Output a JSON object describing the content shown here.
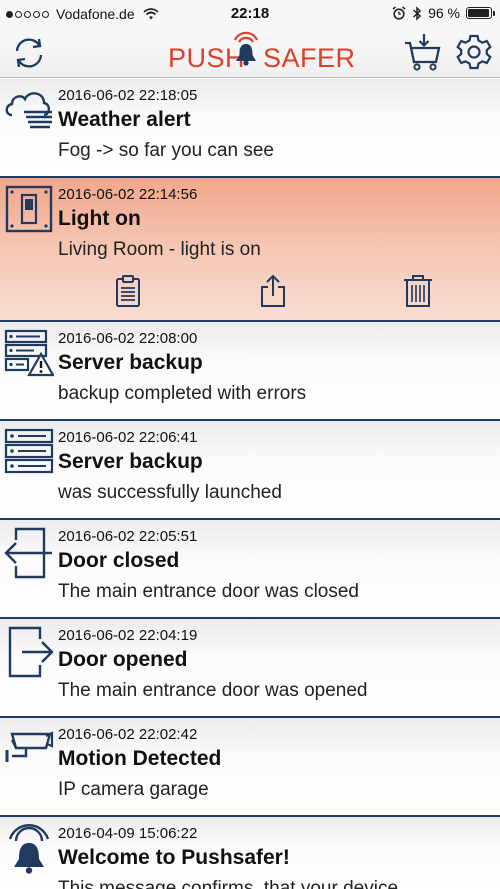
{
  "status_bar": {
    "carrier": "Vodafone.de",
    "time": "22:18",
    "battery": "96 %",
    "battery_level": 0.96,
    "signal_bars": 1
  },
  "nav": {
    "logo_left": "PUSH",
    "logo_right": "SAFER",
    "refresh_icon": "refresh-icon",
    "cart_icon": "cart-download-icon",
    "settings_icon": "gear-icon"
  },
  "colors": {
    "brand_red": "#d9412c",
    "icon_navy": "#203a60",
    "selected_row": "#f4b9a2"
  },
  "messages": [
    {
      "icon": "weather-alert-icon",
      "time": "2016-06-02 22:18:05",
      "title": "Weather alert",
      "body": "Fog -> so far you can see"
    },
    {
      "icon": "light-switch-icon",
      "time": "2016-06-02 22:14:56",
      "title": "Light on",
      "body": "Living Room - light is on",
      "selected": true
    },
    {
      "icon": "server-warning-icon",
      "time": "2016-06-02 22:08:00",
      "title": "Server backup",
      "body": "backup completed with errors"
    },
    {
      "icon": "server-icon",
      "time": "2016-06-02 22:06:41",
      "title": "Server backup",
      "body": "was successfully launched"
    },
    {
      "icon": "door-closed-icon",
      "time": "2016-06-02 22:05:51",
      "title": "Door closed",
      "body": "The main entrance door was closed"
    },
    {
      "icon": "door-opened-icon",
      "time": "2016-06-02 22:04:19",
      "title": "Door opened",
      "body": "The main entrance door was opened"
    },
    {
      "icon": "ip-camera-icon",
      "time": "2016-06-02 22:02:42",
      "title": "Motion Detected",
      "body": "IP camera garage"
    },
    {
      "icon": "pushsafer-bell-icon",
      "time": "2016-04-09 15:06:22",
      "title": "Welcome to Pushsafer!",
      "body": "This message confirms, that your device"
    }
  ],
  "row_actions": [
    "clipboard-icon",
    "share-icon",
    "trash-icon"
  ]
}
